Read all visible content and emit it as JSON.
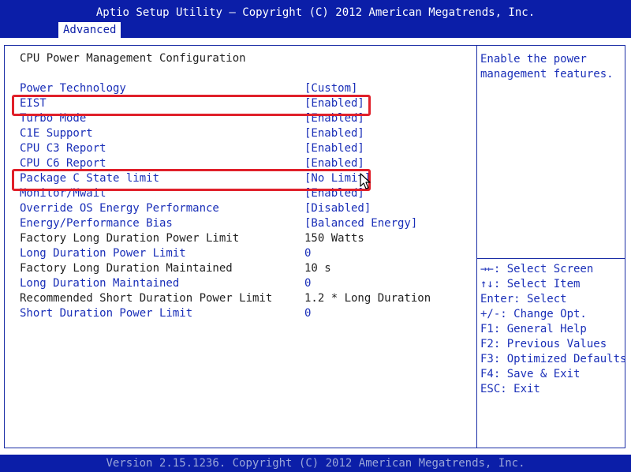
{
  "app_title": "Aptio Setup Utility – Copyright (C) 2012 American Megatrends, Inc.",
  "tabs": [
    {
      "label": "Advanced"
    }
  ],
  "section_title": "CPU Power Management Configuration",
  "settings": [
    {
      "label": "Power Technology",
      "value": "[Custom]"
    },
    {
      "label": "EIST",
      "value": "[Enabled]"
    },
    {
      "label": "Turbo Mode",
      "value": "[Enabled]"
    },
    {
      "label": "C1E Support",
      "value": "[Enabled]"
    },
    {
      "label": "CPU C3 Report",
      "value": "[Enabled]"
    },
    {
      "label": "CPU C6 Report",
      "value": "[Enabled]"
    },
    {
      "label": "Package C State limit",
      "value": "[No Limit]"
    },
    {
      "label": "Monitor/Mwait",
      "value": "[Enabled]"
    },
    {
      "label": "Override OS Energy Performance",
      "value": "[Disabled]"
    },
    {
      "label": "Energy/Performance Bias",
      "value": "[Balanced Energy]"
    },
    {
      "label": "Factory Long Duration Power Limit",
      "value": "150 Watts"
    },
    {
      "label": "Long Duration Power Limit",
      "value": "0"
    },
    {
      "label": "Factory Long Duration Maintained",
      "value": "10 s"
    },
    {
      "label": "Long Duration Maintained",
      "value": "0"
    },
    {
      "label": "Recommended Short Duration Power Limit",
      "value": "1.2 * Long Duration"
    },
    {
      "label": "Short Duration Power Limit",
      "value": "0"
    }
  ],
  "help": {
    "description_lines": [
      "Enable the power",
      "management features."
    ],
    "keys": [
      "→←: Select Screen",
      "↑↓: Select Item",
      "Enter: Select",
      "+/-: Change Opt.",
      "F1: General Help",
      "F2: Previous Values",
      "F3: Optimized Defaults",
      "F4: Save & Exit",
      "ESC: Exit"
    ]
  },
  "footer": "Version 2.15.1236. Copyright (C) 2012 American Megatrends, Inc.",
  "colors": {
    "header_bg": "#0b1ea8",
    "link_text": "#1a2fb8",
    "static_text": "#222222",
    "highlight_border": "#e0202a"
  },
  "icons": {
    "cursor": "mouse-pointer-icon"
  }
}
